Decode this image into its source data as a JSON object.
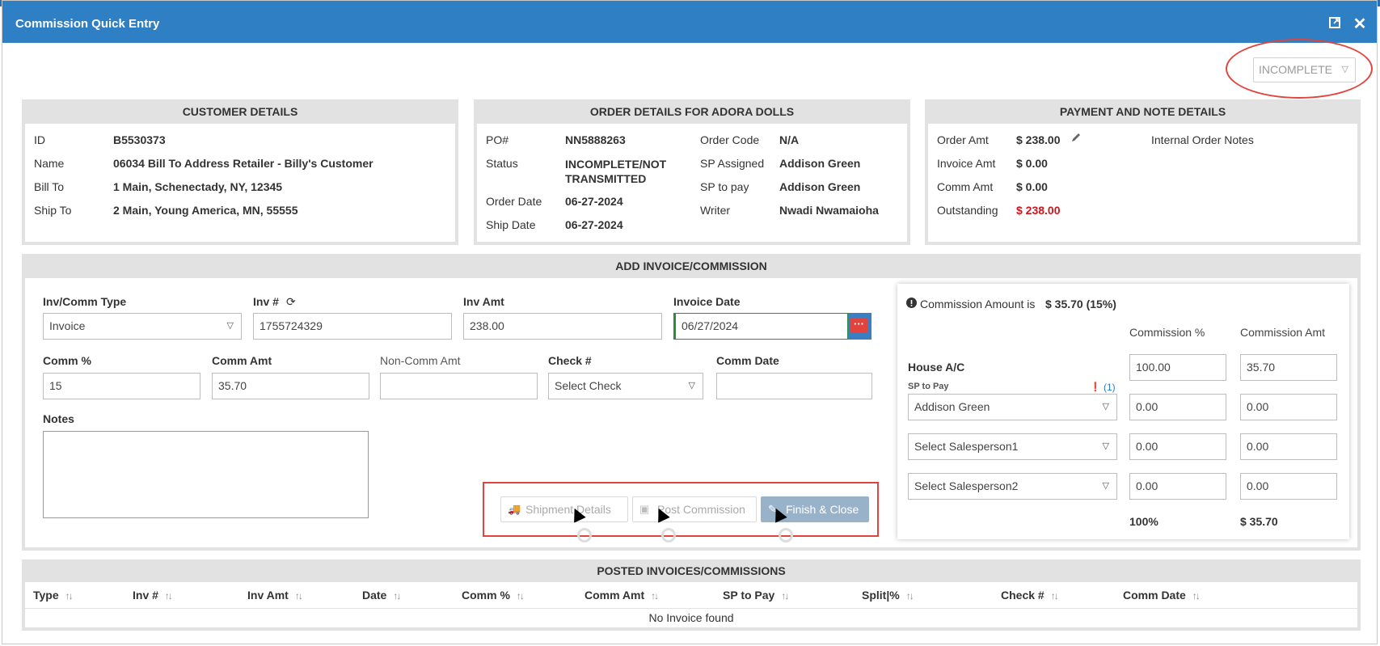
{
  "window": {
    "title": "Commission Quick Entry"
  },
  "status": {
    "value": "INCOMPLETE"
  },
  "customer": {
    "heading": "CUSTOMER DETAILS",
    "rows": [
      {
        "label": "ID",
        "value": "B5530373"
      },
      {
        "label": "Name",
        "value": "06034 Bill To Address Retailer - Billy's Customer"
      },
      {
        "label": "Bill To",
        "value": "1 Main, Schenectady, NY, 12345"
      },
      {
        "label": "Ship To",
        "value": "2 Main, Young America, MN, 55555"
      }
    ]
  },
  "order": {
    "heading": "ORDER DETAILS FOR ADORA DOLLS",
    "left": [
      {
        "label": "PO#",
        "value": "NN5888263"
      },
      {
        "label": "Status",
        "value": "INCOMPLETE/NOT TRANSMITTED"
      },
      {
        "label": "Order Date",
        "value": "06-27-2024"
      },
      {
        "label": "Ship Date",
        "value": "06-27-2024"
      }
    ],
    "right": [
      {
        "label": "Order Code",
        "value": "N/A"
      },
      {
        "label": "SP Assigned",
        "value": "Addison Green"
      },
      {
        "label": "SP to pay",
        "value": "Addison Green"
      },
      {
        "label": "Writer",
        "value": "Nwadi Nwamaioha"
      }
    ]
  },
  "payment": {
    "heading": "PAYMENT AND NOTE DETAILS",
    "rows": [
      {
        "label": "Order Amt",
        "value": "$ 238.00"
      },
      {
        "label": "Invoice Amt",
        "value": "$ 0.00"
      },
      {
        "label": "Comm Amt",
        "value": "$ 0.00"
      },
      {
        "label": "Outstanding",
        "value": "$ 238.00"
      }
    ],
    "notes_label": "Internal Order Notes"
  },
  "add": {
    "heading": "ADD INVOICE/COMMISSION",
    "inv_comm_type": {
      "label": "Inv/Comm Type",
      "value": "Invoice"
    },
    "inv_no": {
      "label": "Inv #",
      "value": "1755724329"
    },
    "inv_amt": {
      "label": "Inv Amt",
      "value": "238.00"
    },
    "invoice_date": {
      "label": "Invoice Date",
      "value": "06/27/2024"
    },
    "comm_pct": {
      "label": "Comm %",
      "value": "15"
    },
    "comm_amt": {
      "label": "Comm Amt",
      "value": "35.70"
    },
    "non_comm_amt": {
      "label": "Non-Comm Amt",
      "value": ""
    },
    "check_no": {
      "label": "Check #",
      "value": "Select Check"
    },
    "comm_date": {
      "label": "Comm Date",
      "value": ""
    },
    "notes": {
      "label": "Notes",
      "value": ""
    },
    "buttons": {
      "shipment": "Shipment Details",
      "post": "Post Commission",
      "finish": "Finish & Close"
    }
  },
  "commission": {
    "info_prefix": "Commission Amount is",
    "info_value": "$ 35.70 (15%)",
    "col_pct": "Commission %",
    "col_amt": "Commission Amt",
    "house_label": "House A/C",
    "house_pct": "100.00",
    "house_amt": "35.70",
    "sp_label": "SP to Pay",
    "sp_count": "(1)",
    "rows": [
      {
        "name": "Addison Green",
        "pct": "0.00",
        "amt": "0.00"
      },
      {
        "name": "Select Salesperson1",
        "pct": "0.00",
        "amt": "0.00"
      },
      {
        "name": "Select Salesperson2",
        "pct": "0.00",
        "amt": "0.00"
      }
    ],
    "total_pct": "100%",
    "total_amt": "$ 35.70"
  },
  "posted": {
    "heading": "POSTED INVOICES/COMMISSIONS",
    "columns": [
      "Type",
      "Inv #",
      "Inv Amt",
      "Date",
      "Comm %",
      "Comm Amt",
      "SP to Pay",
      "Split|%",
      "Check #",
      "Comm Date"
    ],
    "empty_text": "No Invoice found"
  }
}
